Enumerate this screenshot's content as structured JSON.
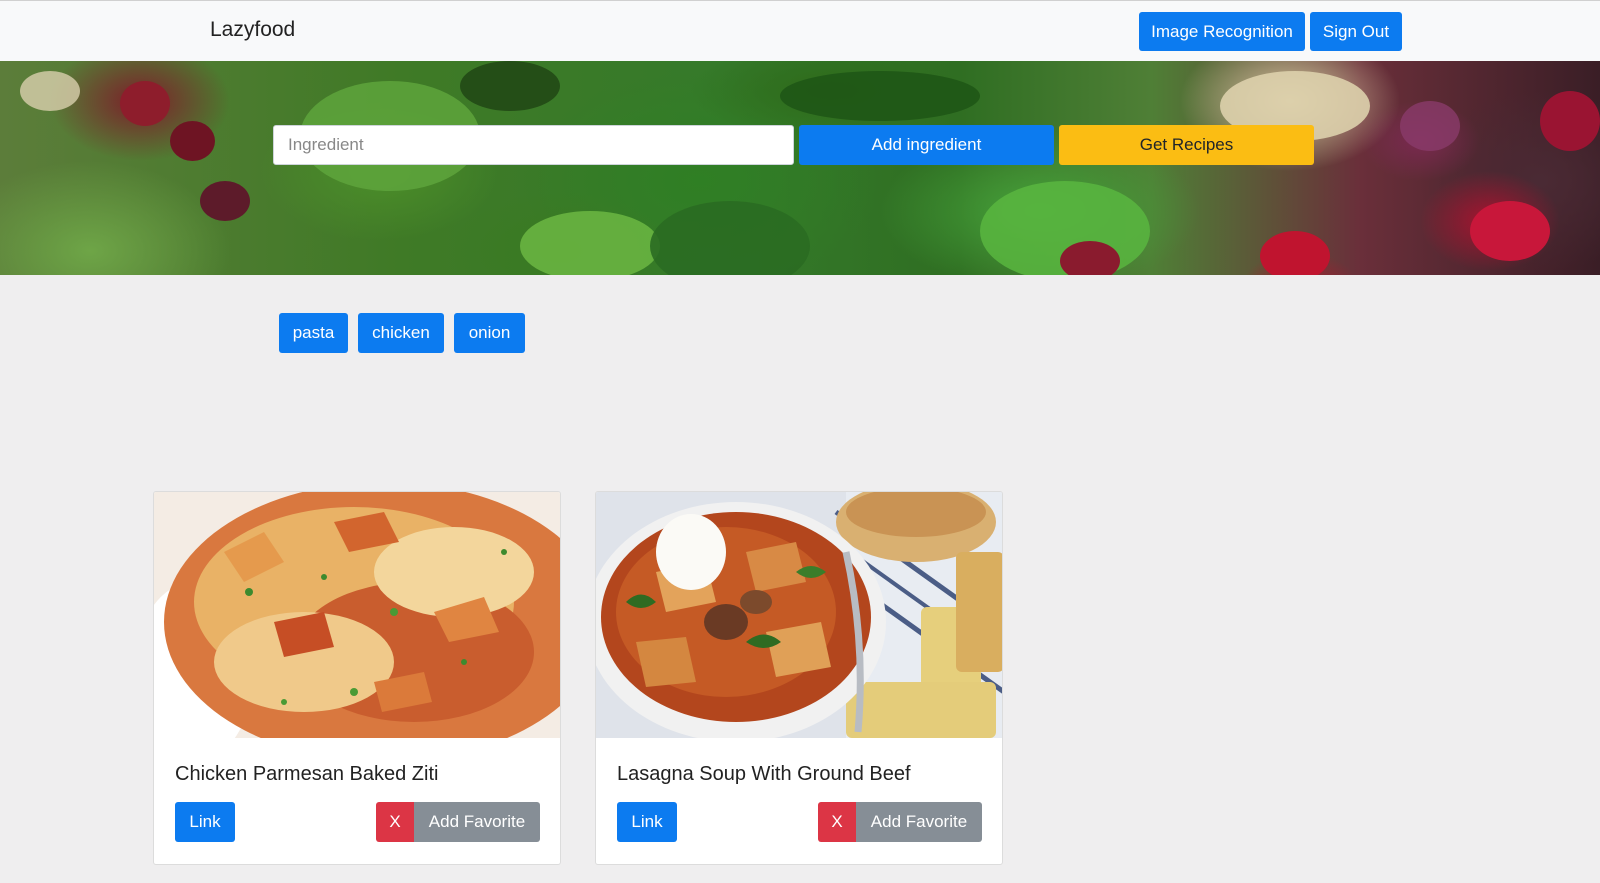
{
  "navbar": {
    "brand": "Lazyfood",
    "image_recognition_label": "Image Recognition",
    "sign_out_label": "Sign Out"
  },
  "search": {
    "placeholder": "Ingredient",
    "value": "",
    "add_label": "Add ingredient",
    "get_recipes_label": "Get Recipes"
  },
  "ingredients": [
    "pasta",
    "chicken",
    "onion"
  ],
  "recipes": [
    {
      "title": "Chicken Parmesan Baked Ziti",
      "link_label": "Link",
      "remove_label": "X",
      "favorite_label": "Add Favorite"
    },
    {
      "title": "Lasagna Soup With Ground Beef",
      "link_label": "Link",
      "remove_label": "X",
      "favorite_label": "Add Favorite"
    }
  ],
  "colors": {
    "primary": "#0c7bf0",
    "warning": "#fbbd13",
    "danger": "#dc3545",
    "secondary": "#868e96",
    "page_bg": "#efeeef"
  }
}
